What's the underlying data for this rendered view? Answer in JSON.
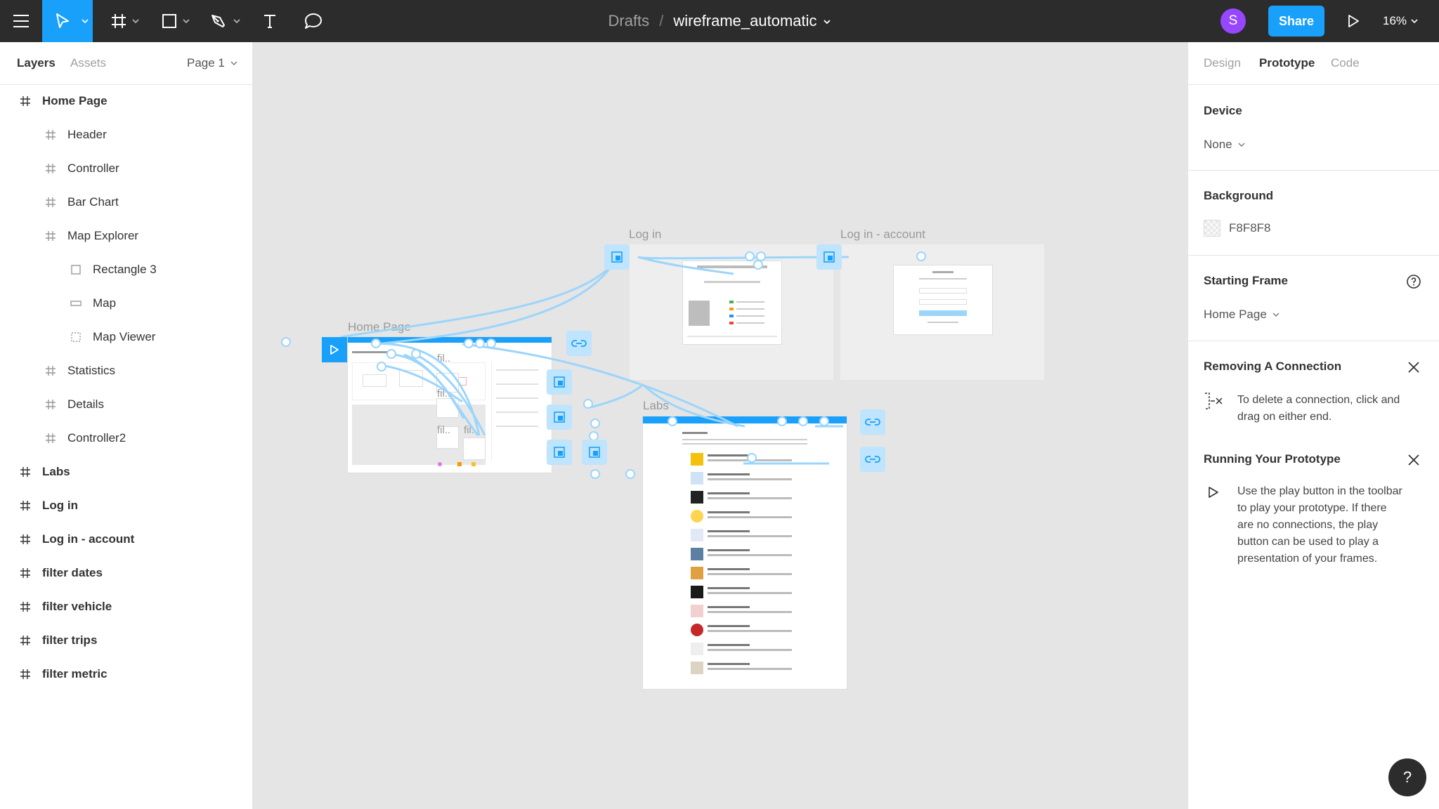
{
  "toolbar": {
    "breadcrumb_parent": "Drafts",
    "breadcrumb_separator": "/",
    "file_name": "wireframe_automatic",
    "avatar_initial": "S",
    "share_label": "Share",
    "zoom": "16%",
    "accent_color": "#18a0fb",
    "avatar_color": "#9747ff"
  },
  "left_panel": {
    "tabs": [
      "Layers",
      "Assets"
    ],
    "page_select": "Page 1",
    "layers": [
      {
        "name": "Home Page",
        "icon": "frame-icon"
      },
      {
        "name": "Header",
        "icon": "frame-icon"
      },
      {
        "name": "Controller",
        "icon": "frame-icon"
      },
      {
        "name": "Bar Chart",
        "icon": "frame-icon"
      },
      {
        "name": "Map Explorer",
        "icon": "frame-icon"
      },
      {
        "name": "Rectangle 3",
        "icon": "rectangle-icon"
      },
      {
        "name": "Map",
        "icon": "component-icon"
      },
      {
        "name": "Map Viewer",
        "icon": "group-icon"
      },
      {
        "name": "Statistics",
        "icon": "frame-icon"
      },
      {
        "name": "Details",
        "icon": "frame-icon"
      },
      {
        "name": "Controller2",
        "icon": "frame-icon"
      },
      {
        "name": "Labs",
        "icon": "frame-icon"
      },
      {
        "name": "Log in",
        "icon": "frame-icon"
      },
      {
        "name": "Log in - account",
        "icon": "frame-icon"
      },
      {
        "name": "filter dates",
        "icon": "frame-icon"
      },
      {
        "name": "filter vehicle",
        "icon": "frame-icon"
      },
      {
        "name": "filter trips",
        "icon": "frame-icon"
      },
      {
        "name": "filter metric",
        "icon": "frame-icon"
      }
    ]
  },
  "canvas": {
    "frames": {
      "home_page": "Home Page",
      "log_in": "Log in",
      "log_in_account": "Log in - account",
      "labs": "Labs",
      "filter_1": "fil..",
      "filter_2": "fil..",
      "filter_3": "fil..",
      "filter_4": "fil.."
    },
    "connection_color": "#9cd5fb"
  },
  "right_panel": {
    "tabs": [
      "Design",
      "Prototype",
      "Code"
    ],
    "device": {
      "title": "Device",
      "value": "None"
    },
    "background": {
      "title": "Background",
      "value": "F8F8F8"
    },
    "starting_frame": {
      "title": "Starting Frame",
      "value": "Home Page"
    },
    "removing_connection": {
      "title": "Removing A Connection",
      "text": "To delete a connection, click and drag on either end."
    },
    "running_prototype": {
      "title": "Running Your Prototype",
      "text": "Use the play button in the toolbar to play your prototype. If there are no connections, the play button can be used to play a presentation of your frames."
    },
    "help": "?"
  }
}
